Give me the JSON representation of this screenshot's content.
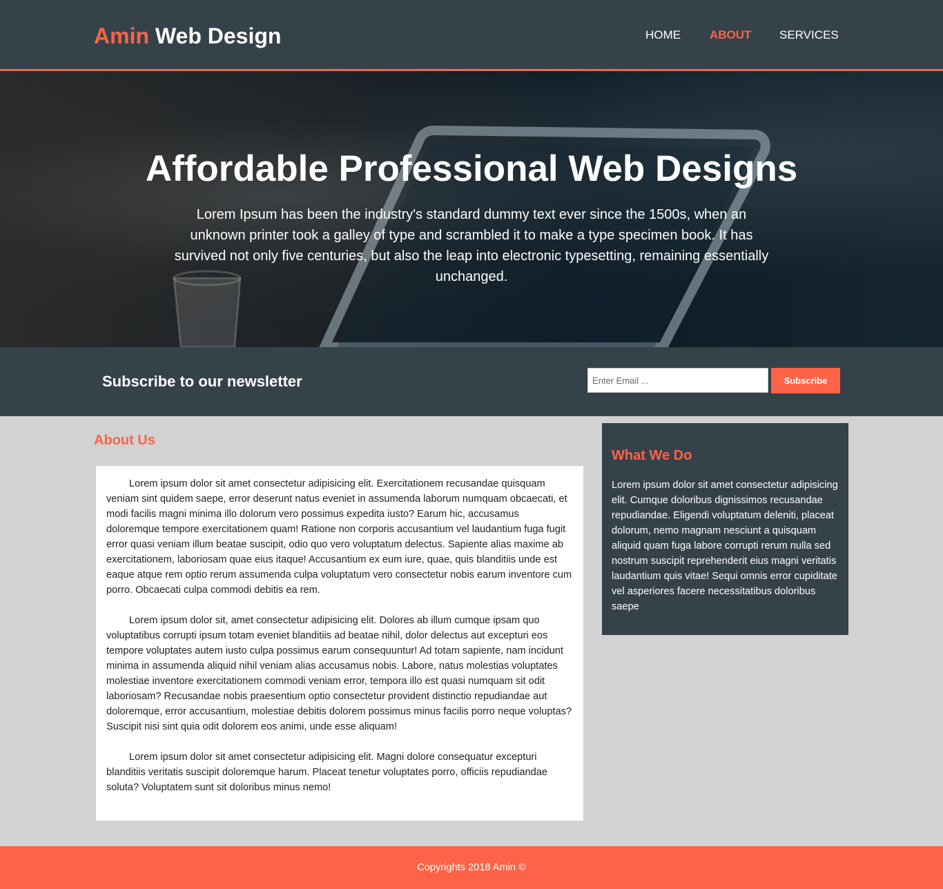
{
  "header": {
    "brand_highlight": "Amin",
    "brand_rest": "Web Design",
    "nav": [
      {
        "label": "HOME"
      },
      {
        "label": "ABOUT"
      },
      {
        "label": "SERVICES"
      }
    ]
  },
  "hero": {
    "title": "Affordable Professional Web Designs",
    "text": "Lorem Ipsum has been the industry's standard dummy text ever since the 1500s, when an unknown printer took a galley of type and scrambled it to make a type specimen book. It has survived not only five centuries, but also the leap into electronic typesetting, remaining essentially unchanged."
  },
  "newsletter": {
    "title": "Subscribe to our newsletter",
    "email_placeholder": "Enter Email ...",
    "button_label": "Subscribe"
  },
  "about": {
    "heading": "About Us",
    "paragraphs": [
      "Lorem ipsum dolor sit amet consectetur adipisicing elit. Exercitationem recusandae quisquam veniam sint quidem saepe, error deserunt natus eveniet in assumenda laborum numquam obcaecati, et modi facilis magni minima illo dolorum vero possimus expedita iusto? Earum hic, accusamus doloremque tempore exercitationem quam! Ratione non corporis accusantium vel laudantium fuga fugit error quasi veniam illum beatae suscipit, odio quo vero voluptatum delectus. Sapiente alias maxime ab exercitationem, laboriosam quae eius itaque! Accusantium ex eum iure, quae, quis blanditiis unde est eaque atque rem optio rerum assumenda culpa voluptatum vero consectetur nobis earum inventore cum porro. Obcaecati culpa commodi debitis ea rem.",
      "Lorem ipsum dolor sit, amet consectetur adipisicing elit. Dolores ab illum cumque ipsam quo voluptatibus corrupti ipsum totam eveniet blanditiis ad beatae nihil, dolor delectus aut excepturi eos tempore voluptates autem iusto culpa possimus earum consequuntur! Ad totam sapiente, nam incidunt minima in assumenda aliquid nihil veniam alias accusamus nobis. Labore, natus molestias voluptates molestiae inventore exercitationem commodi veniam error, tempora illo est quasi numquam sit odit laboriosam? Recusandae nobis praesentium optio consectetur provident distinctio repudiandae aut doloremque, error accusantium, molestiae debitis dolorem possimus minus facilis porro neque voluptas? Suscipit nisi sint quia odit dolorem eos animi, unde esse aliquam!",
      "Lorem ipsum dolor sit amet consectetur adipisicing elit. Magni dolore consequatur excepturi blanditiis veritatis suscipit doloremque harum. Placeat tenetur voluptates porro, officiis repudiandae soluta? Voluptatem sunt sit doloribus minus nemo!"
    ]
  },
  "sidebar": {
    "heading": "What We Do",
    "text": "Lorem ipsum dolor sit amet consectetur adipisicing elit. Cumque doloribus dignissimos recusandae repudiandae. Eligendi voluptatum deleniti, placeat dolorum, nemo magnam nesciunt a quisquam aliquid quam fuga labore corrupti rerum nulla sed nostrum suscipit reprehenderit eius magni veritatis laudantium quis vitae! Sequi omnis error cupiditate vel asperiores facere necessitatibus doloribus saepe"
  },
  "footer": {
    "text": "Copyrights 2018 Amin ©"
  },
  "colors": {
    "accent": "#ff6347",
    "dark": "#36424a",
    "page_bg": "#d2d2d2"
  }
}
